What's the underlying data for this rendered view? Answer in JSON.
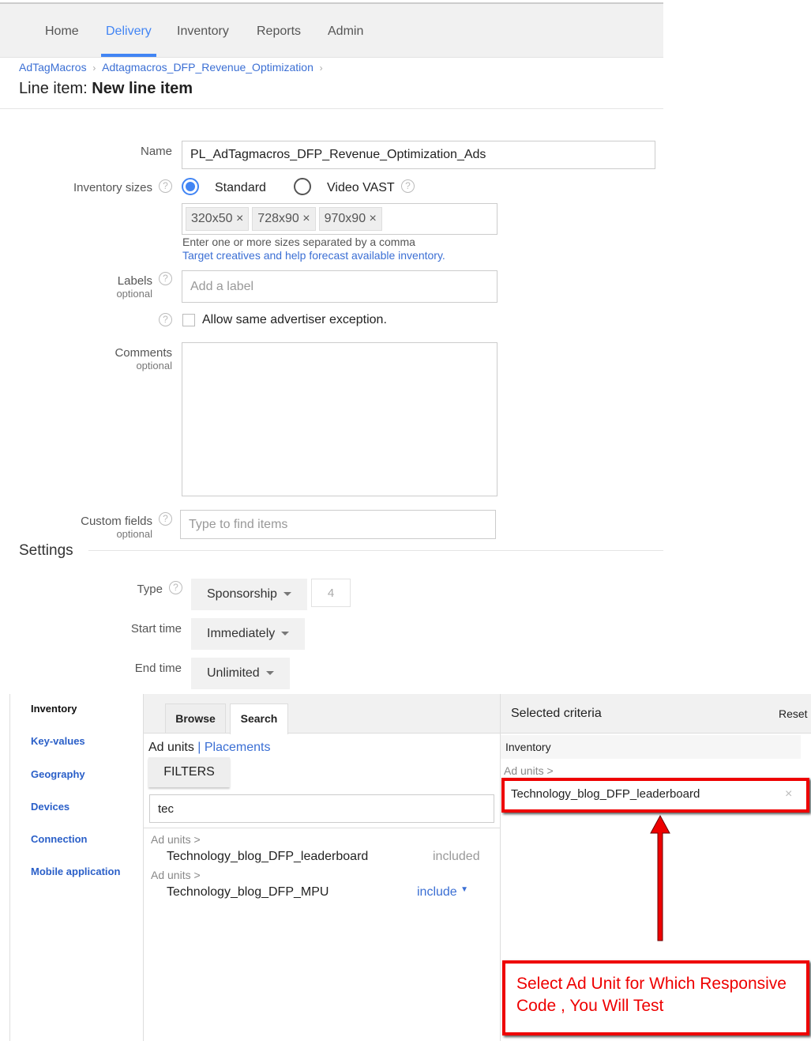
{
  "nav": {
    "items": [
      "Home",
      "Delivery",
      "Inventory",
      "Reports",
      "Admin"
    ],
    "active": "Delivery"
  },
  "breadcrumb": [
    "AdTagMacros",
    "Adtagmacros_DFP_Revenue_Optimization"
  ],
  "title": {
    "prefix": "Line item: ",
    "name": "New line item"
  },
  "form": {
    "name_label": "Name",
    "name_value": "PL_AdTagmacros_DFP_Revenue_Optimization_Ads",
    "inv_label": "Inventory sizes",
    "radio_standard": "Standard",
    "radio_vast": "Video VAST",
    "selected": "Standard",
    "sizes": [
      "320x50",
      "728x90",
      "970x90"
    ],
    "sizes_hint": "Enter one or more sizes separated by a comma",
    "sizes_link": "Target creatives and help forecast available inventory.",
    "labels_label": "Labels",
    "optional": "optional",
    "labels_placeholder": "Add a label",
    "exception_label": "Allow same advertiser exception.",
    "comments_label": "Comments",
    "custom_label": "Custom fields",
    "custom_placeholder": "Type to find items"
  },
  "settings": {
    "heading": "Settings",
    "type_label": "Type",
    "type_value": "Sponsorship",
    "type_number": "4",
    "start_label": "Start time",
    "start_value": "Immediately",
    "end_label": "End time",
    "end_value": "Unlimited"
  },
  "targeting": {
    "sidebar": [
      "Inventory",
      "Key-values",
      "Geography",
      "Devices",
      "Connection",
      "Mobile application"
    ],
    "tabs": [
      "Browse",
      "Search"
    ],
    "active_tab": "Search",
    "ad_units": "Ad units",
    "placements": "Placements",
    "filters": "FILTERS",
    "search_value": "tec",
    "results": [
      {
        "path": "Ad units >",
        "name": "Technology_blog_DFP_leaderboard",
        "action": "included"
      },
      {
        "path": "Ad units >",
        "name": "Technology_blog_DFP_MPU",
        "action": "include"
      }
    ],
    "selected_title": "Selected criteria",
    "reset": "Reset",
    "sel_inventory": "Inventory",
    "sel_path": "Ad units >",
    "sel_item": "Technology_blog_DFP_leaderboard"
  },
  "annotation": {
    "text": "Select Ad Unit for Which Responsive Code , You Will Test",
    "color": "#e00000"
  }
}
